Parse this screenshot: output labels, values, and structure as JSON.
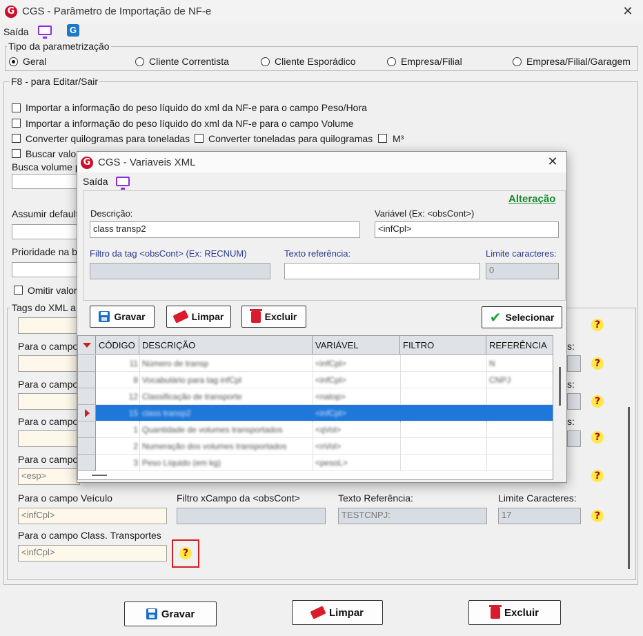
{
  "window": {
    "title": "CGS - Parâmetro de Importação de NF-e",
    "logo_letter": "G",
    "close": "✕"
  },
  "toolbar": {
    "saida": "Saída",
    "g_letter": "G"
  },
  "tipo": {
    "label": "Tipo da parametrização",
    "options": [
      "Geral",
      "Cliente Correntista",
      "Cliente Esporádico",
      "Empresa/Filial",
      "Empresa/Filial/Garagem"
    ],
    "selected": "Geral"
  },
  "f8": {
    "label": "F8 - para Editar/Sair",
    "chk_peso_hora": "Importar a informação do peso líquido do xml da NF-e para o campo Peso/Hora",
    "chk_peso_volume": "Importar a informação do peso líquido do xml da NF-e para o campo Volume",
    "chk_kg_ton": "Converter quilogramas para toneladas",
    "chk_ton_kg": "Converter toneladas para quilogramas",
    "chk_m3": "M³",
    "chk_buscar": "Buscar valor",
    "busca_volume": "Busca volume p",
    "assumir_default": "Assumir default",
    "prioridade": "Prioridade na bu",
    "omitir": "Omitir valor"
  },
  "tags": {
    "label": "Tags do XML a",
    "para_o_campo": "Para o campo",
    "row_esp_value": "<esp>",
    "veiculo": {
      "label": "Para o campo Veículo",
      "value": "<infCpl>",
      "filtro_label": "Filtro xCampo da <obsCont>",
      "filtro_value": "",
      "texto_label": "Texto Referência:",
      "texto_value": "TESTCNPJ:",
      "limite_label": "Limite Caracteres:",
      "limite_value": "17"
    },
    "class_transp": {
      "label": "Para o campo Class. Transportes",
      "value": "<infCpl>"
    },
    "help": "?",
    "s_suffix": "s:"
  },
  "bottom": {
    "gravar": "Gravar",
    "limpar": "Limpar",
    "excluir": "Excluir"
  },
  "dialog": {
    "title": "CGS - Variaveis XML",
    "logo_letter": "G",
    "close": "✕",
    "saida": "Saída",
    "status": "Alteração",
    "descricao_label": "Descrição:",
    "descricao_value": "class transp2",
    "variavel_label": "Variável (Ex: <obsCont>)",
    "variavel_value": "<infCpl>",
    "filtro_label": "Filtro da tag <obsCont> (Ex: RECNUM)",
    "filtro_value": "",
    "texto_label": "Texto referência:",
    "texto_value": "",
    "limite_label": "Limite caracteres:",
    "limite_value": "0",
    "btn_gravar": "Gravar",
    "btn_limpar": "Limpar",
    "btn_excluir": "Excluir",
    "btn_selecionar": "Selecionar",
    "grid": {
      "columns": [
        "CÓDIGO",
        "DESCRIÇÃO",
        "VARIÁVEL",
        "FILTRO",
        "REFERÊNCIA"
      ],
      "rows": [
        [
          "11",
          "Número de transp",
          "<infCpl>",
          "",
          "N"
        ],
        [
          "8",
          "Vocabulário para tag infCpl",
          "<infCpl>",
          "",
          "CNPJ"
        ],
        [
          "12",
          "Classificação de transporte",
          "<natop>",
          "",
          ""
        ],
        [
          "15",
          "class transp2",
          "<infCpl>",
          "",
          ""
        ],
        [
          "1",
          "Quantidade de volumes transportados",
          "<qVol>",
          "",
          ""
        ],
        [
          "2",
          "Numeração dos volumes transportados",
          "<nVol>",
          "",
          ""
        ],
        [
          "3",
          "Peso Líquido (em kg)",
          "<pesoL>",
          "",
          ""
        ]
      ],
      "selected_index": 3
    }
  }
}
